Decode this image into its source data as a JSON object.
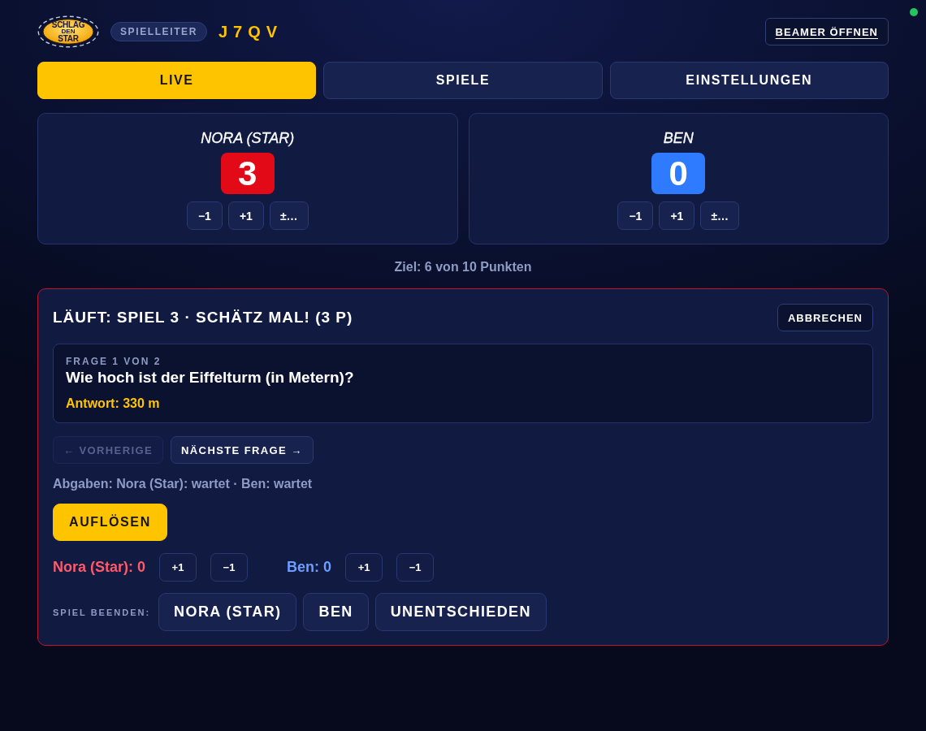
{
  "header": {
    "logo": {
      "lines": [
        "SCHLAG",
        "DEN",
        "STAR"
      ]
    },
    "role_badge": "SPIELLEITER",
    "room_code": "J7QV",
    "beamer_button": "BEAMER ÖFFNEN"
  },
  "status_indicator": {
    "connected": true
  },
  "tabs": [
    {
      "label": "LIVE",
      "selected": true
    },
    {
      "label": "SPIELE",
      "selected": false
    },
    {
      "label": "EINSTELLUNGEN",
      "selected": false
    }
  ],
  "players": [
    {
      "name": "NORA (STAR)",
      "score": "3",
      "color": "#e30a17",
      "buttons": [
        "−1",
        "+1",
        "±…"
      ]
    },
    {
      "name": "BEN",
      "score": "0",
      "color": "#2f7bff",
      "buttons": [
        "−1",
        "+1",
        "±…"
      ]
    }
  ],
  "goal": "Ziel: 6 von 10 Punkten",
  "running_game": {
    "title": "LÄUFT: SPIEL 3 · SCHÄTZ MAL! (3 P)",
    "cancel_button": "ABBRECHEN",
    "question": {
      "counter": "FRAGE 1 VON 2",
      "text": "Wie hoch ist der Eiffelturm (in Metern)?",
      "answer": "Antwort: 330 m"
    },
    "navigation": [
      {
        "label": "← VORHERIGE",
        "disabled": true
      },
      {
        "label": "NÄCHSTE FRAGE →",
        "disabled": false
      }
    ],
    "submissions": "Abgaben: Nora (Star): wartet · Ben: wartet",
    "reveal_button": "AUFLÖSEN",
    "round_points": [
      {
        "label": "Nora (Star): 0",
        "color": "#ff5a6a",
        "buttons": [
          "+1",
          "−1"
        ]
      },
      {
        "label": "Ben: 0",
        "color": "#6d9eff",
        "buttons": [
          "+1",
          "−1"
        ]
      }
    ],
    "end_game": {
      "label": "SPIEL BEENDEN:",
      "buttons": [
        "NORA (STAR)",
        "BEN",
        "UNENTSCHIEDEN"
      ]
    }
  }
}
